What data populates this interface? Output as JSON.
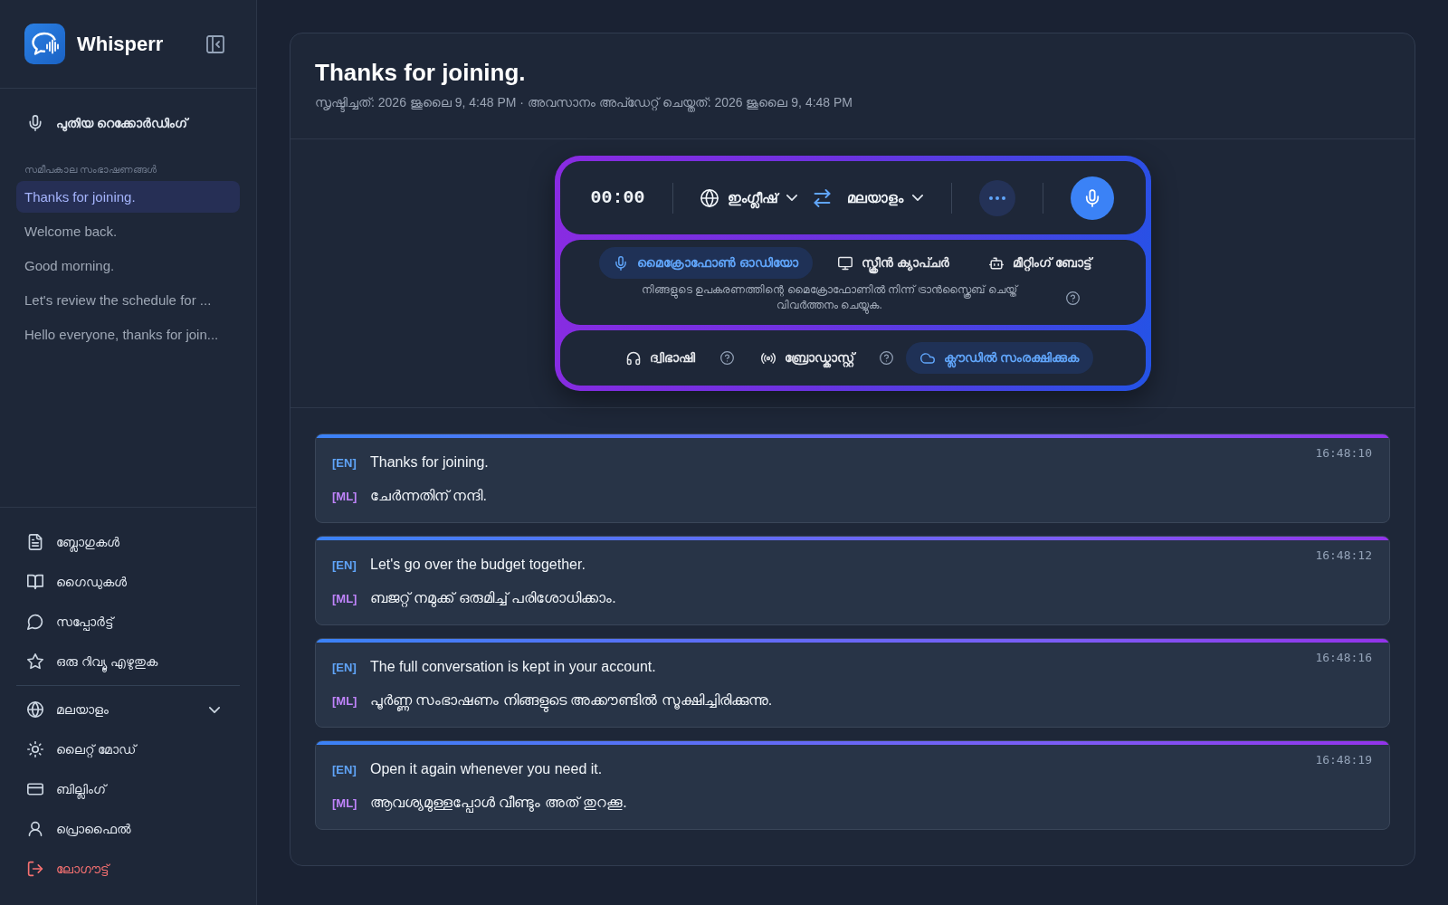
{
  "sidebar": {
    "brand": "Whisperr",
    "new_recording": "പുതിയ റെക്കോർഡിംഗ്",
    "recent_heading": "സമീപകാല സംഭാഷണങ്ങൾ",
    "recent": [
      {
        "title": "Thanks for joining.",
        "selected": true
      },
      {
        "title": "Welcome back.",
        "selected": false
      },
      {
        "title": "Good morning.",
        "selected": false
      },
      {
        "title": "Let's review the schedule for ...",
        "selected": false
      },
      {
        "title": "Hello everyone, thanks for join...",
        "selected": false
      }
    ],
    "links": [
      {
        "kind": "blogs",
        "label": "ബ്ലോഗുകൾ"
      },
      {
        "kind": "guides",
        "label": "ഗൈഡുകൾ"
      },
      {
        "kind": "support",
        "label": "സപ്പോർട്ട്"
      },
      {
        "kind": "review",
        "label": "ഒരു റിവ്യൂ എഴുതുക"
      }
    ],
    "settings": [
      {
        "kind": "language",
        "label": "മലയാളം"
      },
      {
        "kind": "theme",
        "label": "ലൈറ്റ് മോഡ്"
      },
      {
        "kind": "billing",
        "label": "ബില്ലിംഗ്"
      },
      {
        "kind": "profile",
        "label": "പ്രൊഫൈൽ"
      },
      {
        "kind": "logout",
        "label": "ലോഗൗട്ട്"
      }
    ]
  },
  "conversation": {
    "title": "Thanks for joining.",
    "meta": "സൃഷ്ടിച്ചത്: 2026 ജൂലൈ 9, 4:48 PM · അവസാനം അപ്ഡേറ്റ് ചെയ്തത്: 2026 ജൂലൈ 9, 4:48 PM"
  },
  "recorder": {
    "timer": "00:00",
    "source_language": "ഇംഗ്ലീഷ്",
    "target_language": "മലയാളം",
    "sources": [
      {
        "kind": "microphone",
        "label": "മൈക്രോഫോൺ ഓഡിയോ",
        "selected": true
      },
      {
        "kind": "screen",
        "label": "സ്ക്രീൻ ക്യാപ്ചർ",
        "selected": false
      },
      {
        "kind": "bot",
        "label": "മീറ്റിംഗ് ബോട്ട്",
        "selected": false
      }
    ],
    "source_description": "നിങ്ങളുടെ ഉപകരണത്തിന്റെ മൈക്രോഫോണിൽ നിന്ന് ട്രാൻസ്ക്രൈബ് ചെയ്ത് വിവർത്തനം ചെയ്യുക.",
    "options": [
      {
        "kind": "bilingual",
        "label": "ദ്വിഭാഷി",
        "on": false,
        "help": true
      },
      {
        "kind": "broadcast",
        "label": "ബ്രോഡ്കാസ്റ്റ്",
        "on": false,
        "help": true
      },
      {
        "kind": "cloud",
        "label": "ക്ലൗഡിൽ സംരക്ഷിക്കുക",
        "on": true,
        "help": false
      }
    ]
  },
  "transcript": [
    {
      "time": "16:48:10",
      "lines": [
        {
          "kind": "source",
          "tag": "[EN]",
          "text": "Thanks for joining."
        },
        {
          "kind": "translation",
          "tag": "[ML]",
          "text": "ചേർന്നതിന് നന്ദി."
        }
      ]
    },
    {
      "time": "16:48:12",
      "lines": [
        {
          "kind": "source",
          "tag": "[EN]",
          "text": "Let's go over the budget together."
        },
        {
          "kind": "translation",
          "tag": "[ML]",
          "text": "ബജറ്റ് നമുക്ക് ഒരുമിച്ച് പരിശോധിക്കാം."
        }
      ]
    },
    {
      "time": "16:48:16",
      "lines": [
        {
          "kind": "source",
          "tag": "[EN]",
          "text": "The full conversation is kept in your account."
        },
        {
          "kind": "translation",
          "tag": "[ML]",
          "text": "പൂർണ്ണ സംഭാഷണം നിങ്ങളുടെ അക്കൗണ്ടിൽ സൂക്ഷിച്ചിരിക്കുന്നു."
        }
      ]
    },
    {
      "time": "16:48:19",
      "lines": [
        {
          "kind": "source",
          "tag": "[EN]",
          "text": "Open it again whenever you need it."
        },
        {
          "kind": "translation",
          "tag": "[ML]",
          "text": "ആവശ്യമുള്ളപ്പോൾ വീണ്ടും അത് തുറക്കൂ."
        }
      ]
    }
  ]
}
